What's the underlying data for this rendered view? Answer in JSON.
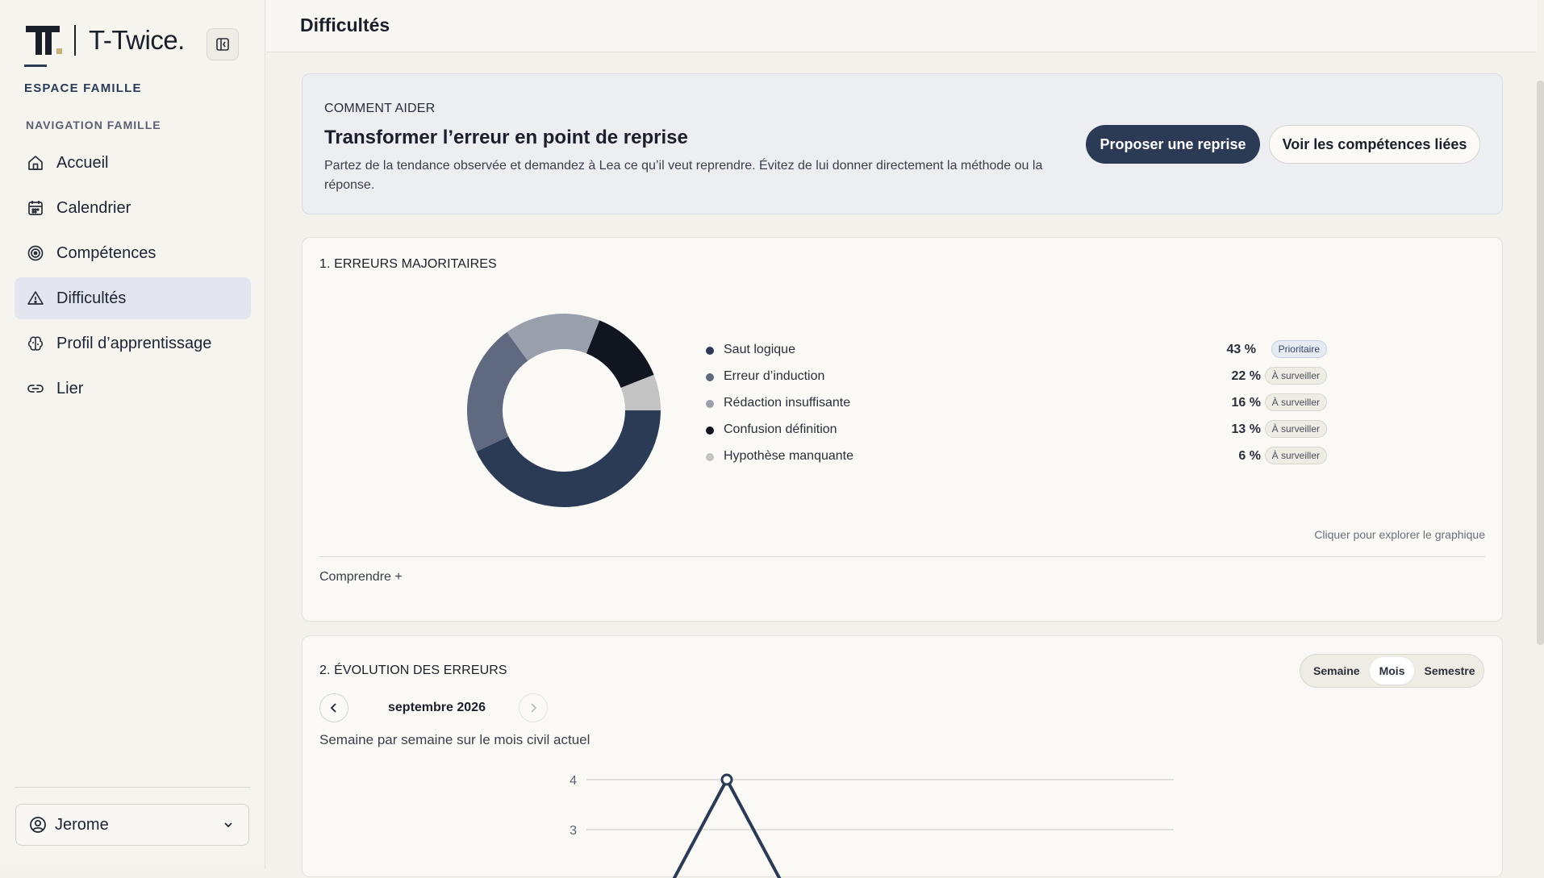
{
  "sidebar": {
    "brand_name": "T-Twice.",
    "space_label": "ESPACE FAMILLE",
    "nav_label": "NAVIGATION FAMILLE",
    "items": [
      {
        "label": "Accueil",
        "icon": "home-icon"
      },
      {
        "label": "Calendrier",
        "icon": "calendar-icon"
      },
      {
        "label": "Compétences",
        "icon": "target-icon"
      },
      {
        "label": "Difficultés",
        "icon": "warning-icon",
        "active": true
      },
      {
        "label": "Profil d’apprentissage",
        "icon": "brain-icon"
      },
      {
        "label": "Lier",
        "icon": "link-icon"
      }
    ],
    "user": "Jerome"
  },
  "header": {
    "title": "Difficultés"
  },
  "help": {
    "eyebrow": "COMMENT AIDER",
    "title": "Transformer l’erreur en point de reprise",
    "text": "Partez de la tendance observée et demandez à Lea ce qu’il veut reprendre. Évitez de lui donner directement la méthode ou la réponse.",
    "primary_button": "Proposer une reprise",
    "secondary_button": "Voir les compétences liées"
  },
  "errors": {
    "title": "1. ERREURS MAJORITAIRES",
    "explore_hint": "Cliquer pour explorer le graphique",
    "understand_label": "Comprendre +"
  },
  "chart_data": [
    {
      "type": "pie",
      "categories": [
        "Saut logique",
        "Erreur d’induction",
        "Rédaction insuffisante",
        "Confusion définition",
        "Hypothèse manquante"
      ],
      "values": [
        43,
        22,
        16,
        13,
        6
      ],
      "value_labels": [
        "43 %",
        "22 %",
        "16 %",
        "13 %",
        "6 %"
      ],
      "badges": [
        "Prioritaire",
        "À surveiller",
        "À surveiller",
        "À surveiller",
        "À surveiller"
      ],
      "colors": [
        "#2b3a55",
        "#5f6a80",
        "#9aa0ab",
        "#111520",
        "#c3c3c3"
      ]
    },
    {
      "type": "line",
      "y_ticks": [
        3,
        4
      ],
      "peak_value": 4,
      "color": "#2b3a55"
    }
  ],
  "evolution": {
    "title": "2. ÉVOLUTION DES ERREURS",
    "period_options": [
      "Semaine",
      "Mois",
      "Semestre"
    ],
    "selected_period": "Mois",
    "month": "septembre 2026",
    "subtitle": "Semaine par semaine sur le mois civil actuel",
    "y_tick_4": "4",
    "y_tick_3": "3"
  }
}
